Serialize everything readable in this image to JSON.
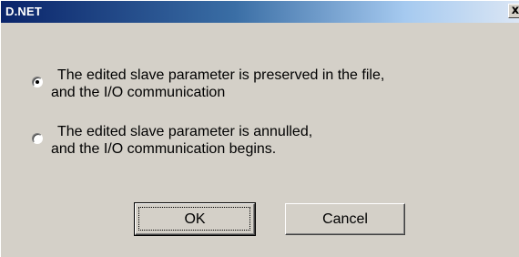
{
  "window": {
    "title": "D.NET",
    "close_glyph": "x",
    "close_icon": "close-icon"
  },
  "options": [
    {
      "line1": "The edited slave parameter is preserved in the file,",
      "line2": "and the I/O communication",
      "selected": true
    },
    {
      "line1": "The edited slave parameter is annulled,",
      "line2": "and the I/O communication begins.",
      "selected": false
    }
  ],
  "buttons": {
    "ok_label": "OK",
    "cancel_label": "Cancel"
  },
  "colors": {
    "face": "#d4d0c8",
    "title_start": "#0a246a",
    "title_end": "#dbe6f4"
  }
}
